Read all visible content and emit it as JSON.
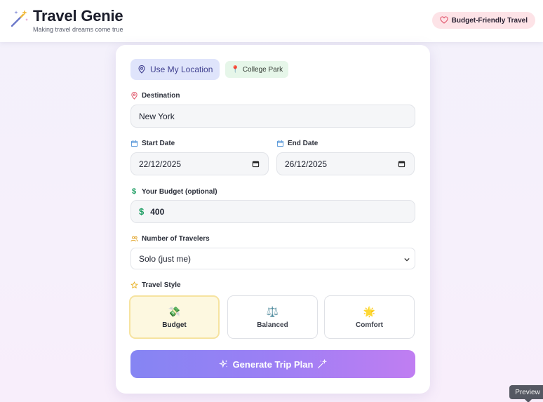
{
  "header": {
    "title": "Travel Genie",
    "subtitle": "Making travel dreams come true",
    "badge": "Budget-Friendly Travel",
    "brand_icon": "magic-wand-icon"
  },
  "location": {
    "button_label": "Use My Location",
    "current": "College Park"
  },
  "destination": {
    "label": "Destination",
    "value": "New York"
  },
  "dates": {
    "start_label": "Start Date",
    "start_value": "22/12/2025",
    "end_label": "End Date",
    "end_value": "26/12/2025"
  },
  "budget": {
    "label": "Your Budget (optional)",
    "currency": "$",
    "value": "400"
  },
  "travelers": {
    "label": "Number of Travelers",
    "selected": "Solo (just me)"
  },
  "travel_style": {
    "label": "Travel Style",
    "options": [
      {
        "name": "Budget",
        "emoji": "💸",
        "selected": true
      },
      {
        "name": "Balanced",
        "emoji": "⚖️",
        "selected": false
      },
      {
        "name": "Comfort",
        "emoji": "🌟",
        "selected": false
      }
    ]
  },
  "generate": {
    "label": "Generate Trip Plan"
  },
  "tooltip": {
    "label": "Preview"
  },
  "colors": {
    "accent": "#8585f3",
    "badge_bg": "#fde3e7",
    "location_bg": "#dfe4fb",
    "chip_bg": "#e6f6e9",
    "selected_style_bg": "#fdf8e0"
  }
}
